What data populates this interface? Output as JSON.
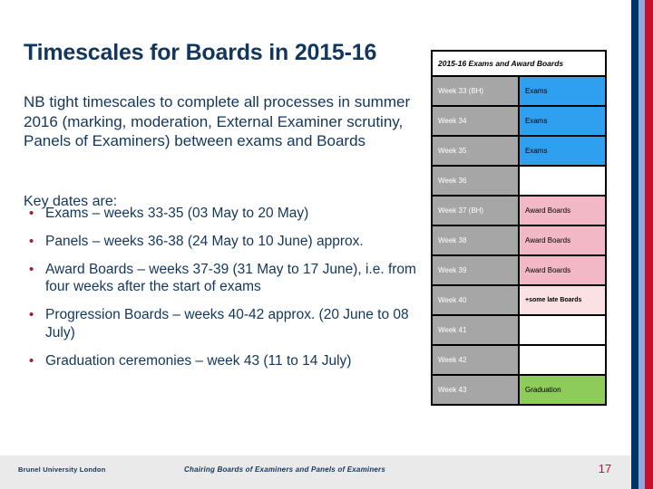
{
  "slide": {
    "title": "Timescales for Boards in 2015-16",
    "nb_paragraph": "NB tight timescales to complete all processes in summer 2016 (marking, moderation, External Examiner scrutiny, Panels of Examiners) between exams and Boards",
    "key_dates_heading": "Key dates are:",
    "bullet_marker": "•",
    "bullets": [
      "Exams – weeks 33-35 (03 May to 20 May)",
      "Panels – weeks 36-38 (24 May to 10 June) approx.",
      "Award Boards – weeks 37-39 (31 May to 17 June), i.e. from four weeks after the start of exams",
      "Progression Boards – weeks 40-42 approx. (20 June to 08 July)",
      "Graduation ceremonies – week 43 (11 to 14 July)"
    ]
  },
  "table": {
    "header": "2015-16 Exams and Award Boards",
    "rows": [
      {
        "week": "Week 33 (BH)",
        "value": "Exams",
        "style": "c-exams"
      },
      {
        "week": "Week 34",
        "value": "Exams",
        "style": "c-exams"
      },
      {
        "week": "Week 35",
        "value": "Exams",
        "style": "c-exams"
      },
      {
        "week": "Week 36",
        "value": "",
        "style": "c-blank"
      },
      {
        "week": "Week 37 (BH)",
        "value": "Award Boards",
        "style": "c-award"
      },
      {
        "week": "Week 38",
        "value": "Award Boards",
        "style": "c-award"
      },
      {
        "week": "Week 39",
        "value": "Award  Boards",
        "style": "c-award"
      },
      {
        "week": "Week 40",
        "value": "+some late Boards",
        "style": "c-late"
      },
      {
        "week": "Week 41",
        "value": "",
        "style": "c-blank"
      },
      {
        "week": "Week 42",
        "value": "",
        "style": "c-blank"
      },
      {
        "week": "Week 43",
        "value": "Graduation",
        "style": "c-grad"
      }
    ]
  },
  "footer": {
    "organisation": "Brunel University London",
    "deck_title": "Chairing Boards of Examiners and Panels of Examiners",
    "page_number": "17"
  },
  "colors": {
    "title_navy": "#13365c",
    "bullet_maroon": "#9e1b32",
    "edge_navy": "#003366",
    "edge_light_blue": "#8fa8dc",
    "edge_red": "#c8102e",
    "week_grey": "#a6a6a6",
    "exams_blue": "#2f9ff0",
    "award_pink": "#f2b8c6",
    "late_pink": "#fbe0e4",
    "graduation_green": "#8dcc5a",
    "footer_band": "#eaeaea"
  }
}
